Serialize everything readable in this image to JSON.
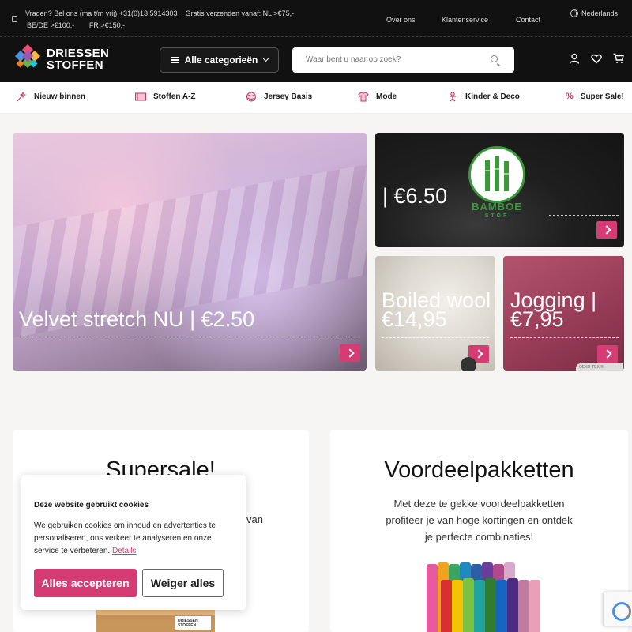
{
  "topbar": {
    "contact_prefix": "Vragen? Bel ons (ma t/m vrij)",
    "phone": "+31(0)13 5914303",
    "shipping": "Gratis verzenden vanaf: NL >€75,-",
    "shipping_be": "BE/DE >€100,-",
    "shipping_fr": "FR >€150,-",
    "nav": [
      "Over ons",
      "Klantenservice",
      "Contact"
    ],
    "language": "Nederlands"
  },
  "header": {
    "logo_line1": "DRIESSEN",
    "logo_line2": "STOFFEN",
    "categories_label": "Alle categorieën",
    "search_placeholder": "Waar bent u naar op zoek?"
  },
  "categories": [
    {
      "label": "Nieuw binnen",
      "icon": "sparkle-icon"
    },
    {
      "label": "Stoffen A-Z",
      "icon": "fabric-roll-icon"
    },
    {
      "label": "Jersey Basis",
      "icon": "yarn-icon"
    },
    {
      "label": "Mode",
      "icon": "shirt-icon"
    },
    {
      "label": "Kinder & Deco",
      "icon": "gingerbread-icon"
    },
    {
      "label": "Super Sale!",
      "icon": "percent-icon"
    }
  ],
  "tiles": {
    "velvet": "Velvet stretch NU | €2.50",
    "bamboe": "| €6.50",
    "bamboe_logo_line1": "BAMBOE",
    "bamboe_logo_line2": "STOF",
    "boiled_line1": "Boiled wool |",
    "boiled_line2": "€14,95",
    "jogging_line1": "Jogging |",
    "jogging_line2": "€7,95",
    "oeko_badge": "OEKO-TEX ®"
  },
  "cards": {
    "supersale_title": "Supersale!",
    "supersale_fragment": "van",
    "voordeel_title": "Voordeelpakketten",
    "voordeel_desc_1": "Met deze te gekke voordeelpakketten",
    "voordeel_desc_2": "profiteer je van hoge kortingen en ontdek",
    "voordeel_desc_3": "je perfecte combinaties!",
    "box_label": "DRIESSEN STOFFEN"
  },
  "cookie": {
    "title": "Deze website gebruikt cookies",
    "text": "We gebruiken cookies om inhoud en advertenties te personaliseren, ons verkeer te analyseren en onze service te verbeteren.",
    "details_link": "Details",
    "accept": "Alles accepteren",
    "deny": "Weiger alles"
  },
  "colors": {
    "accent": "#d63c74",
    "dark": "#111111"
  }
}
